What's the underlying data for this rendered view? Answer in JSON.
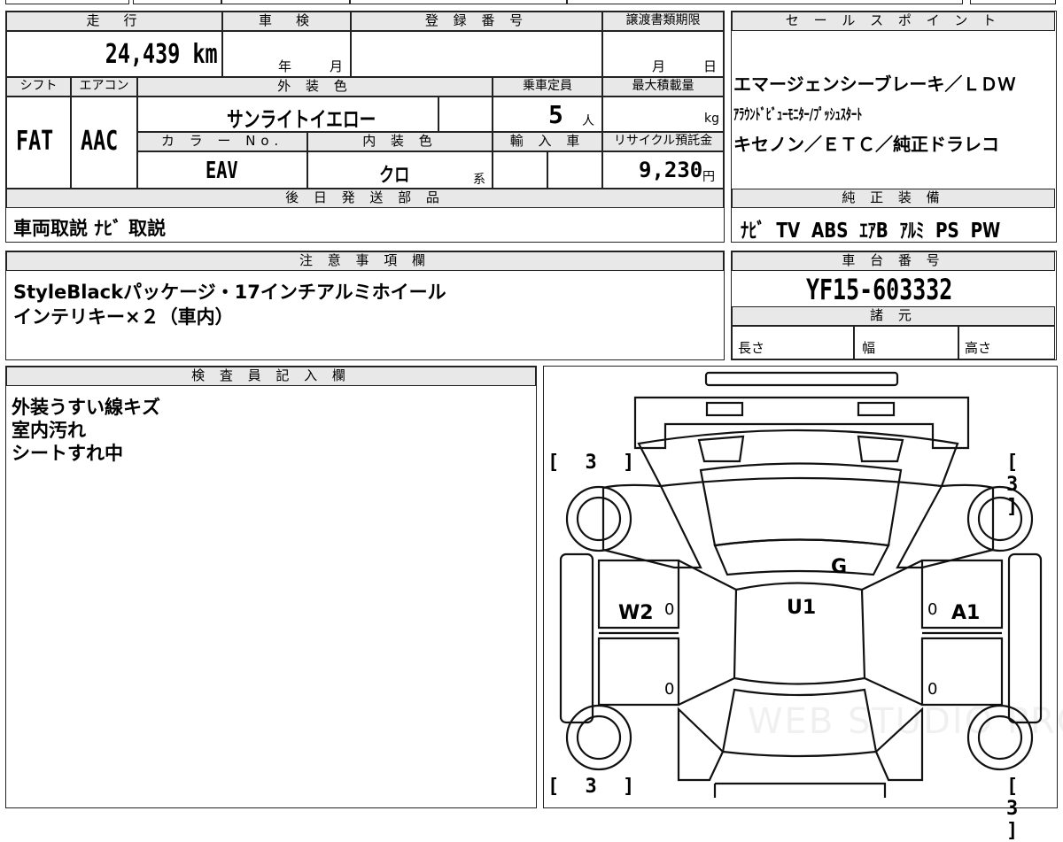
{
  "top_partial": {
    "cells": [
      "",
      "",
      "",
      "",
      ""
    ]
  },
  "vehicle": {
    "labels": {
      "mileage": "走　行",
      "inspection": "車　検",
      "registration": "登 録 番 号",
      "transfer_deadline": "譲渡書類期限",
      "shift": "シフト",
      "aircon": "エアコン",
      "exterior_color": "外 装 色",
      "capacity": "乗車定員",
      "max_load": "最大積載量",
      "color_no": "カ ラ ー No.",
      "interior_color": "内 装 色",
      "import": "輸 入 車",
      "recycle": "リサイクル預託金",
      "year_unit": "年",
      "month_unit": "月",
      "deadline_month": "月",
      "deadline_day": "日",
      "capacity_unit": "人",
      "load_unit": "kg",
      "interior_suffix": "系",
      "yen_unit": "円"
    },
    "mileage": "24,439 km",
    "shift": "FAT",
    "aircon": "AAC",
    "exterior_color": "サンライトイエロー",
    "capacity": "5",
    "color_no": "EAV",
    "interior_color": "クロ",
    "recycle_fee": "9,230"
  },
  "later_shipping": {
    "header": "後 日 発 送 部 品",
    "text": "車両取説 ﾅﾋﾞ 取説"
  },
  "notes": {
    "header": "注 意 事 項 欄",
    "lines": [
      "StyleBlackパッケージ・17インチアルミホイール",
      "インテリキー×２（車内）"
    ]
  },
  "inspector": {
    "header": "検 査 員 記 入 欄",
    "lines": [
      "外装うすい線キズ",
      "室内汚れ",
      "シートすれ中"
    ]
  },
  "sales_points": {
    "header": "セ ー ル ス ポ イ ン ト",
    "lines": [
      "エマージェンシーブレーキ／ＬＤＷ",
      "ｱﾗｳﾝﾄﾞﾋﾞｭｰﾓﾆﾀｰ/ﾌﾟｯｼｭｽﾀｰﾄ",
      "キセノン／ＥＴＣ／純正ドラレコ"
    ]
  },
  "equipment": {
    "header": "純 正 装 備",
    "items": [
      "ﾅﾋﾞ",
      "TV",
      "ABS",
      "ｴｱB",
      "ｱﾙﾐ",
      "PS",
      "PW"
    ]
  },
  "chassis": {
    "header": "車 台 番 号",
    "number": "YF15-603332"
  },
  "specs": {
    "header": "諸 元",
    "length": "長さ",
    "width": "幅",
    "height": "高さ"
  },
  "diagram": {
    "tire_fl": "[ 3 ]",
    "tire_fr": "[ 3 ]",
    "tire_rl": "[ 3 ]",
    "tire_rr": "[ 3 ]",
    "mark_g": "G",
    "mark_u1": "U1",
    "mark_w2": "W2",
    "mark_a1": "A1",
    "zero_marks": [
      "0",
      "0",
      "0",
      "0"
    ],
    "watermark": "WEB STUDIO PRO"
  }
}
